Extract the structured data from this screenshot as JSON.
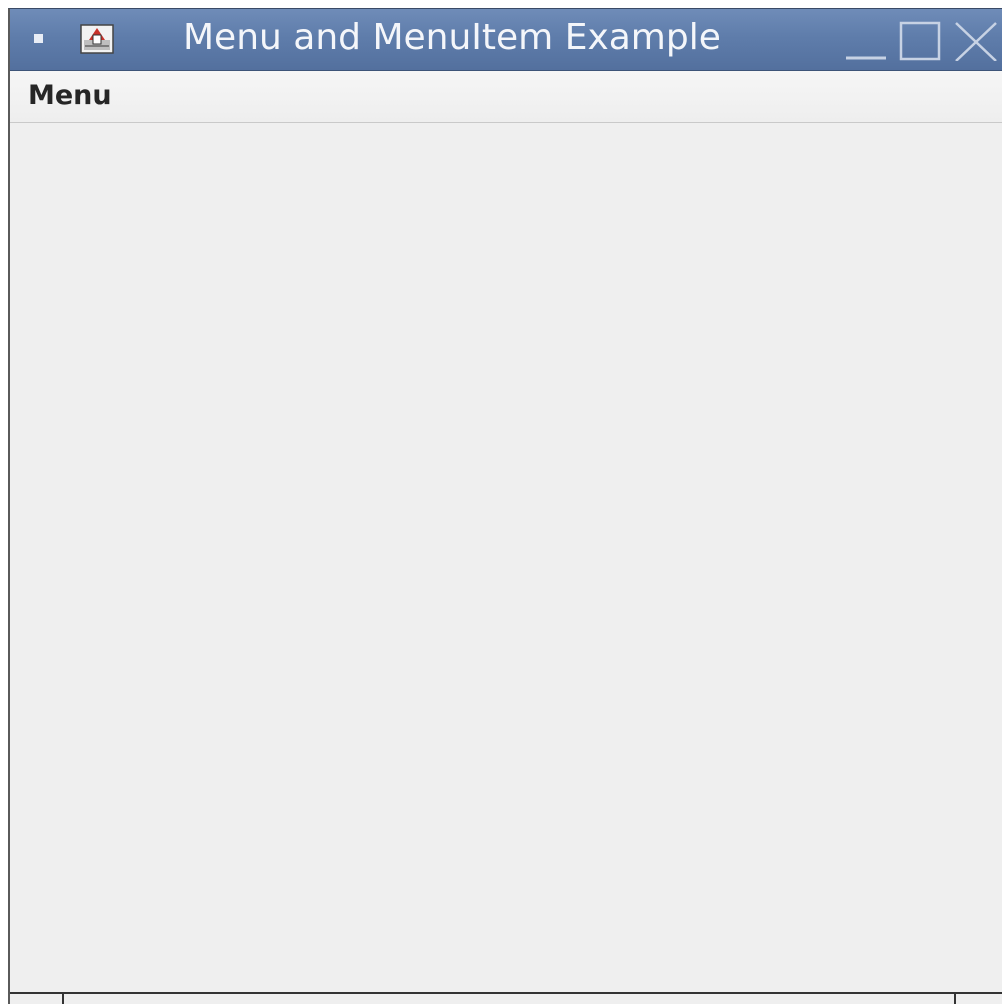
{
  "window": {
    "title": "Menu and MenuItem Example",
    "icon": "java-app-icon",
    "controls": [
      "minimize-icon",
      "maximize-icon",
      "close-icon"
    ]
  },
  "menubar": {
    "items": [
      {
        "label": "Menu"
      }
    ]
  },
  "colors": {
    "titlebar": "#5f7dab",
    "title_text": "#f4f6fa",
    "background": "#efefef"
  }
}
